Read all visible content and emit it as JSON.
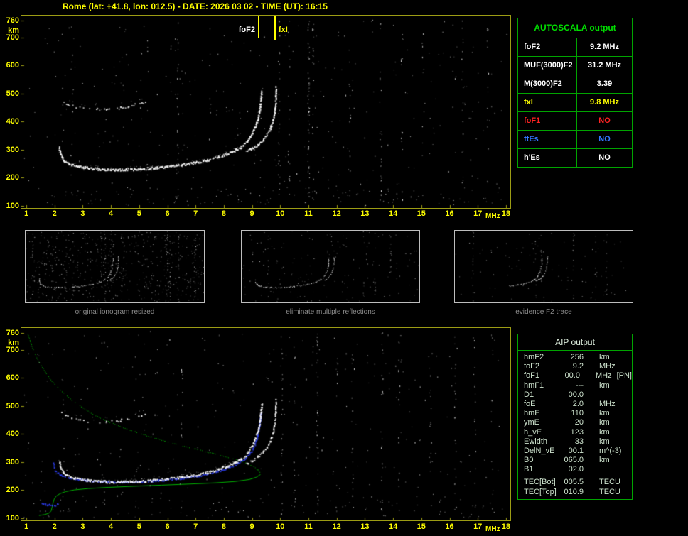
{
  "title": "Rome (lat: +41.8, lon: 012.5) - DATE: 2026 03 02 - TIME (UT): 16:15",
  "colors": {
    "background": "#000000",
    "title": "#ffff00",
    "axis_label": "#ffff00",
    "plot_border": "#9c9c14",
    "table_border": "#00a400",
    "autoscala_header": "#00dd00",
    "aip_text": "#cde2cd",
    "caption": "#8c8c8c",
    "trace": "#ffffff",
    "profile_green": "#00b400",
    "scaled_trace_blue": "#2a3ae0",
    "marker_line": "#ffff00"
  },
  "autoscala_table": {
    "header": "AUTOSCALA output",
    "rows": [
      {
        "label": "foF2",
        "value": "9.2 MHz",
        "color": "#ffffff"
      },
      {
        "label": "MUF(3000)F2",
        "value": "31.2 MHz",
        "color": "#ffffff"
      },
      {
        "label": "M(3000)F2",
        "value": "3.39",
        "color": "#ffffff"
      },
      {
        "label": "fxI",
        "value": "9.8 MHz",
        "color": "#ffff00"
      },
      {
        "label": "foF1",
        "value": "NO",
        "color": "#ff2222"
      },
      {
        "label": "ftEs",
        "value": "NO",
        "color": "#3377ff"
      },
      {
        "label": "h'Es",
        "value": "NO",
        "color": "#ffffff"
      }
    ]
  },
  "aip_table": {
    "header": "AIP output",
    "rows": [
      {
        "label": "hmF2",
        "value": "256",
        "unit": "km"
      },
      {
        "label": "foF2",
        "value": "9.2",
        "unit": "MHz"
      },
      {
        "label": "foF1",
        "value": "00.0",
        "unit": "MHz",
        "extra": "[PN]"
      },
      {
        "label": "hmF1",
        "value": "---",
        "unit": "km"
      },
      {
        "label": "D1",
        "value": "00.0",
        "unit": ""
      },
      {
        "label": "foE",
        "value": "2.0",
        "unit": "MHz"
      },
      {
        "label": "hmE",
        "value": "110",
        "unit": "km"
      },
      {
        "label": "ymE",
        "value": "20",
        "unit": "km"
      },
      {
        "label": "h_vE",
        "value": "123",
        "unit": "km"
      },
      {
        "label": "Ewidth",
        "value": "33",
        "unit": "km"
      },
      {
        "label": "DelN_vE",
        "value": "00.1",
        "unit": "m^(-3)"
      },
      {
        "label": "B0",
        "value": "065.0",
        "unit": "km"
      },
      {
        "label": "B1",
        "value": "02.0",
        "unit": ""
      },
      {
        "label": "TEC[Bot]",
        "value": "005.5",
        "unit": "TECU",
        "divider_above": true
      },
      {
        "label": "TEC[Top]",
        "value": "010.9",
        "unit": "TECU"
      }
    ]
  },
  "thumbnails": [
    {
      "caption": "original ionogram resized",
      "series": [
        "F2-trace-O",
        "F2-trace-X",
        "second-hop"
      ],
      "noise": 520,
      "columns": 14
    },
    {
      "caption": "eliminate multiple reflections",
      "series": [
        "F2-trace-O",
        "F2-trace-X"
      ],
      "noise": 150,
      "columns": 5
    },
    {
      "caption": "evidence F2 trace",
      "series": [
        "F2-trace-O",
        "F2-trace-X"
      ],
      "noise": 85,
      "columns": 6,
      "f_min": 6.0
    }
  ],
  "chart_data": [
    {
      "type": "scatter",
      "title": "scaled ionogram (top panel)",
      "xlabel": "MHz",
      "ylabel": "km",
      "xlim": [
        1,
        18
      ],
      "ylim": [
        100,
        760
      ],
      "x_ticks": [
        1,
        2,
        3,
        4,
        5,
        6,
        7,
        8,
        9,
        10,
        11,
        12,
        13,
        14,
        15,
        16,
        17,
        18
      ],
      "y_ticks": [
        760,
        700,
        600,
        500,
        400,
        300,
        200,
        100
      ],
      "markers": [
        {
          "label": "foF2",
          "freq_mhz": 9.2
        },
        {
          "label": "fxI",
          "freq_mhz": 9.8
        }
      ],
      "series": [
        {
          "name": "second-hop",
          "color": "#ffffff",
          "points": [
            [
              2.25,
              476
            ],
            [
              2.45,
              464
            ],
            [
              2.7,
              455
            ],
            [
              3.0,
              449
            ],
            [
              3.4,
              446
            ],
            [
              3.8,
              445
            ],
            [
              4.2,
              449
            ],
            [
              4.6,
              456
            ],
            [
              4.9,
              464
            ],
            [
              5.2,
              472
            ]
          ]
        },
        {
          "name": "F2-trace-X",
          "color": "#ffffff",
          "points": [
            [
              8.8,
              296
            ],
            [
              9.0,
              307
            ],
            [
              9.2,
              321
            ],
            [
              9.38,
              337
            ],
            [
              9.52,
              355
            ],
            [
              9.63,
              376
            ],
            [
              9.71,
              399
            ],
            [
              9.77,
              424
            ],
            [
              9.8,
              450
            ],
            [
              9.82,
              477
            ],
            [
              9.83,
              503
            ],
            [
              9.84,
              526
            ]
          ]
        },
        {
          "name": "F2-trace-O",
          "color": "#ffffff",
          "points": [
            [
              2.15,
              308
            ],
            [
              2.2,
              284
            ],
            [
              2.3,
              263
            ],
            [
              2.5,
              250
            ],
            [
              2.8,
              242
            ],
            [
              3.2,
              236
            ],
            [
              3.6,
              233
            ],
            [
              4.0,
              231
            ],
            [
              4.5,
              231
            ],
            [
              5.0,
              233
            ],
            [
              5.5,
              237
            ],
            [
              6.0,
              242
            ],
            [
              6.5,
              248
            ],
            [
              7.0,
              256
            ],
            [
              7.4,
              265
            ],
            [
              7.8,
              276
            ],
            [
              8.1,
              287
            ],
            [
              8.4,
              300
            ],
            [
              8.6,
              312
            ],
            [
              8.8,
              328
            ],
            [
              8.9,
              345
            ],
            [
              9.0,
              363
            ],
            [
              9.1,
              385
            ],
            [
              9.2,
              412
            ],
            [
              9.25,
              438
            ],
            [
              9.28,
              462
            ],
            [
              9.31,
              487
            ],
            [
              9.33,
              508
            ]
          ]
        }
      ],
      "noise": {
        "scatter": 330,
        "bottom_band": 90,
        "interference_columns": [
          {
            "f": 2.6,
            "n": 5
          },
          {
            "f": 5.3,
            "n": 4
          },
          {
            "f": 6.35,
            "n": 14
          },
          {
            "f": 7.5,
            "n": 4
          },
          {
            "f": 9.95,
            "n": 12
          },
          {
            "f": 10.3,
            "n": 8
          },
          {
            "f": 11.0,
            "n": 26
          },
          {
            "f": 11.15,
            "n": 10
          },
          {
            "f": 12.45,
            "n": 7
          },
          {
            "f": 13.55,
            "n": 10
          },
          {
            "f": 14.3,
            "n": 6
          },
          {
            "f": 15.05,
            "n": 5
          },
          {
            "f": 16.45,
            "n": 8
          },
          {
            "f": 17.35,
            "n": 7
          }
        ]
      }
    },
    {
      "type": "scatter",
      "title": "ionogram with restored electron density profile (bottom panel)",
      "xlabel": "MHz",
      "ylabel": "km",
      "xlim": [
        1,
        18
      ],
      "ylim": [
        100,
        760
      ],
      "x_ticks": [
        1,
        2,
        3,
        4,
        5,
        6,
        7,
        8,
        9,
        10,
        11,
        12,
        13,
        14,
        15,
        16,
        17,
        18
      ],
      "y_ticks": [
        760,
        700,
        600,
        500,
        400,
        300,
        200,
        100
      ],
      "series": [
        {
          "name": "profile-topside",
          "color": "#00b400",
          "points": [
            [
              1.05,
              757
            ],
            [
              1.15,
              724
            ],
            [
              1.28,
              690
            ],
            [
              1.45,
              656
            ],
            [
              1.66,
              622
            ],
            [
              1.9,
              589
            ],
            [
              2.2,
              557
            ],
            [
              2.55,
              526
            ],
            [
              2.95,
              497
            ],
            [
              3.4,
              469
            ],
            [
              3.95,
              443
            ],
            [
              4.55,
              419
            ],
            [
              5.2,
              397
            ],
            [
              5.9,
              376
            ],
            [
              6.65,
              356
            ],
            [
              7.4,
              337
            ],
            [
              8.1,
              319
            ],
            [
              8.65,
              303
            ],
            [
              9.0,
              288
            ],
            [
              9.2,
              273
            ],
            [
              9.3,
              260
            ]
          ]
        },
        {
          "name": "profile-bottomside",
          "color": "#00b400",
          "points": [
            [
              9.3,
              256
            ],
            [
              9.15,
              246
            ],
            [
              8.9,
              238
            ],
            [
              8.4,
              231
            ],
            [
              7.7,
              226
            ],
            [
              6.8,
              222
            ],
            [
              5.8,
              218
            ],
            [
              4.8,
              214
            ],
            [
              3.9,
              210
            ],
            [
              3.2,
              206
            ],
            [
              2.7,
              201
            ],
            [
              2.4,
              195
            ],
            [
              2.2,
              188
            ],
            [
              2.05,
              178
            ],
            [
              1.98,
              166
            ],
            [
              1.94,
              152
            ],
            [
              1.91,
              138
            ],
            [
              1.88,
              126
            ],
            [
              1.8,
              118
            ],
            [
              1.65,
              113
            ],
            [
              1.45,
              110
            ]
          ]
        },
        {
          "name": "scaled-trace-O",
          "color": "#2a3ae0",
          "points": [
            [
              1.95,
              296
            ],
            [
              2.0,
              272
            ],
            [
              2.2,
              256
            ],
            [
              2.5,
              246
            ],
            [
              2.9,
              239
            ],
            [
              3.4,
              234
            ],
            [
              3.9,
              231
            ],
            [
              4.5,
              230
            ],
            [
              5.1,
              232
            ],
            [
              5.7,
              236
            ],
            [
              6.3,
              242
            ],
            [
              6.9,
              250
            ],
            [
              7.4,
              259
            ],
            [
              7.8,
              270
            ],
            [
              8.2,
              283
            ],
            [
              8.5,
              298
            ],
            [
              8.8,
              320
            ],
            [
              9.0,
              344
            ],
            [
              9.1,
              368
            ],
            [
              9.18,
              394
            ],
            [
              9.24,
              424
            ],
            [
              9.28,
              454
            ],
            [
              9.31,
              482
            ]
          ]
        },
        {
          "name": "E-layer-scaled",
          "color": "#2a3ae0",
          "points": [
            [
              1.5,
              152
            ],
            [
              1.75,
              150
            ],
            [
              2.0,
              149
            ],
            [
              2.1,
              150
            ]
          ]
        },
        {
          "name": "second-hop",
          "color": "#ffffff",
          "points": [
            [
              2.25,
              476
            ],
            [
              2.45,
              464
            ],
            [
              2.7,
              455
            ],
            [
              3.0,
              449
            ],
            [
              3.4,
              446
            ],
            [
              3.8,
              445
            ],
            [
              4.2,
              449
            ],
            [
              4.6,
              456
            ],
            [
              4.9,
              464
            ],
            [
              5.2,
              472
            ]
          ]
        },
        {
          "name": "F2-trace-X",
          "color": "#ffffff",
          "points": [
            [
              8.8,
              296
            ],
            [
              9.0,
              307
            ],
            [
              9.2,
              321
            ],
            [
              9.38,
              337
            ],
            [
              9.52,
              355
            ],
            [
              9.63,
              376
            ],
            [
              9.71,
              399
            ],
            [
              9.77,
              424
            ],
            [
              9.8,
              450
            ],
            [
              9.82,
              477
            ],
            [
              9.83,
              503
            ],
            [
              9.84,
              526
            ]
          ]
        },
        {
          "name": "F2-trace-O",
          "color": "#ffffff",
          "points": [
            [
              2.15,
              308
            ],
            [
              2.2,
              284
            ],
            [
              2.3,
              263
            ],
            [
              2.5,
              250
            ],
            [
              2.8,
              242
            ],
            [
              3.2,
              236
            ],
            [
              3.6,
              233
            ],
            [
              4.0,
              231
            ],
            [
              4.5,
              231
            ],
            [
              5.0,
              233
            ],
            [
              5.5,
              237
            ],
            [
              6.0,
              242
            ],
            [
              6.5,
              248
            ],
            [
              7.0,
              256
            ],
            [
              7.4,
              265
            ],
            [
              7.8,
              276
            ],
            [
              8.1,
              287
            ],
            [
              8.4,
              300
            ],
            [
              8.6,
              312
            ],
            [
              8.8,
              328
            ],
            [
              8.9,
              345
            ],
            [
              9.0,
              363
            ],
            [
              9.1,
              385
            ],
            [
              9.2,
              412
            ],
            [
              9.25,
              438
            ],
            [
              9.28,
              462
            ],
            [
              9.31,
              487
            ],
            [
              9.33,
              508
            ]
          ]
        }
      ],
      "noise": {
        "scatter": 300,
        "bottom_band": 80,
        "interference_columns": [
          {
            "f": 2.3,
            "n": 5
          },
          {
            "f": 6.5,
            "n": 7
          },
          {
            "f": 10.05,
            "n": 13
          },
          {
            "f": 10.5,
            "n": 7
          },
          {
            "f": 11.3,
            "n": 18
          },
          {
            "f": 12.0,
            "n": 5
          },
          {
            "f": 12.55,
            "n": 8
          },
          {
            "f": 13.6,
            "n": 11
          },
          {
            "f": 14.2,
            "n": 7
          },
          {
            "f": 15.3,
            "n": 6
          },
          {
            "f": 16.2,
            "n": 10
          },
          {
            "f": 16.9,
            "n": 8
          },
          {
            "f": 17.5,
            "n": 6
          }
        ]
      }
    }
  ]
}
